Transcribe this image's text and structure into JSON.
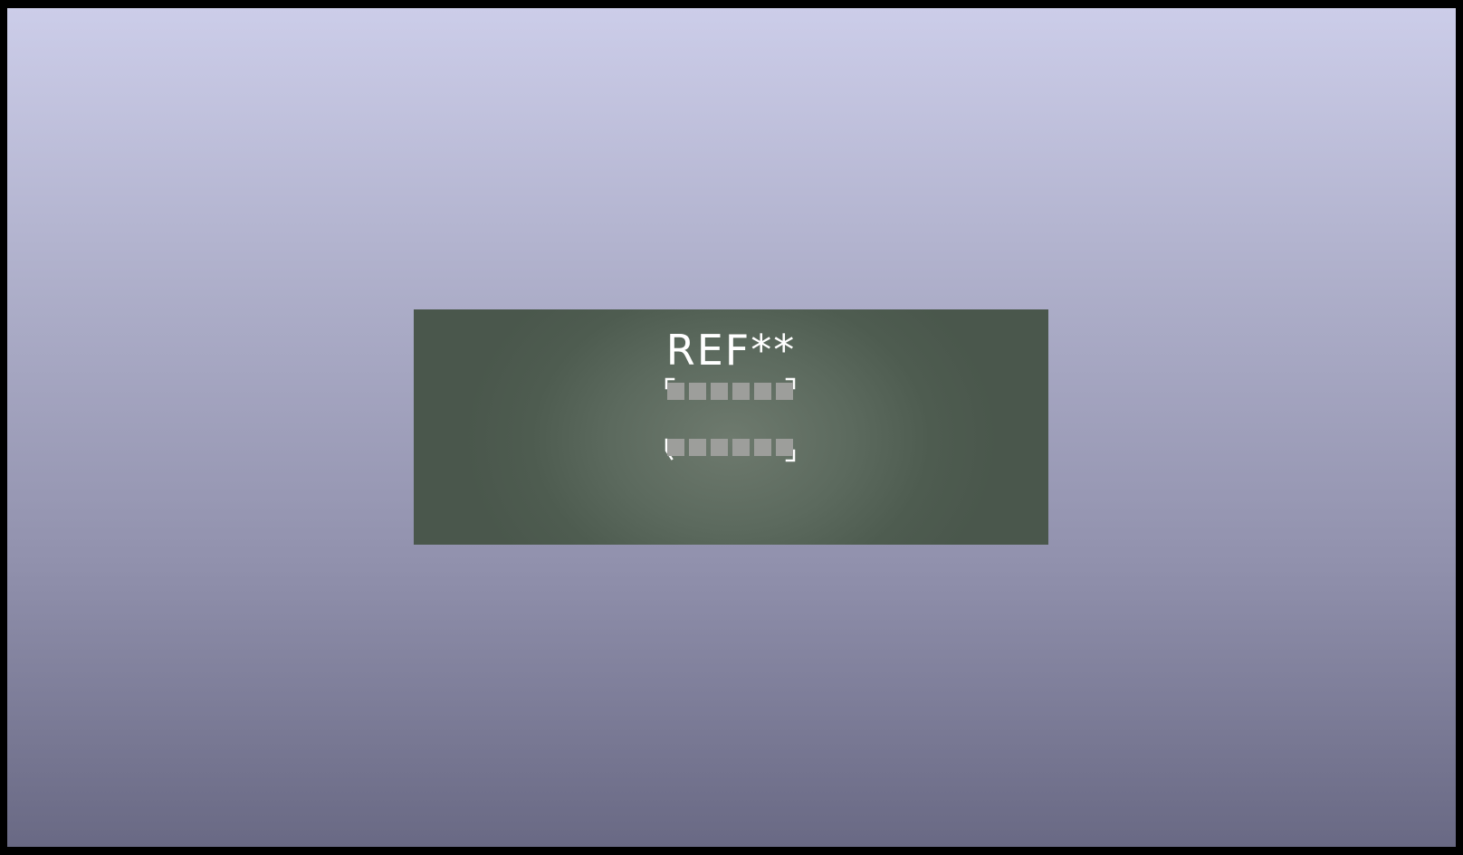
{
  "board": {
    "reference_label": "REF**",
    "pads_top_count": 6,
    "pads_bottom_count": 6,
    "board_color": "#4e5c50",
    "pad_color": "#9d9e9b",
    "silkscreen_color": "#ffffff",
    "background_top_color": "#cccde9",
    "background_bottom_color": "#696984"
  }
}
